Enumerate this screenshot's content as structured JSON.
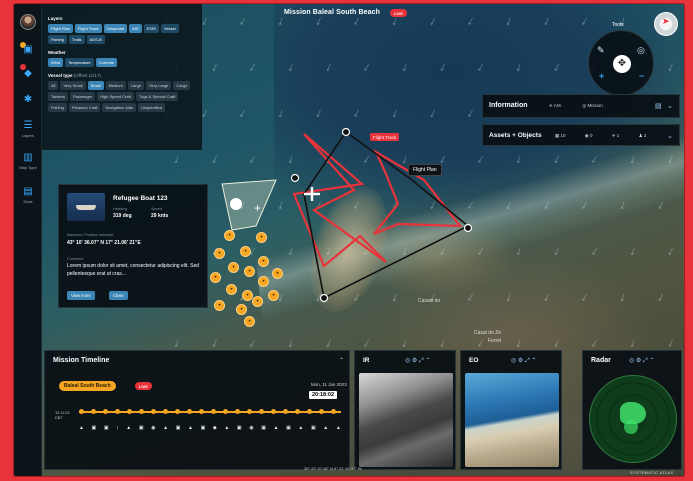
{
  "header": {
    "title": "Mission Baleal South Beach",
    "live": "LIVE"
  },
  "rail": [
    {
      "label": ""
    },
    {
      "label": ""
    },
    {
      "label": ""
    },
    {
      "label": "Layers"
    },
    {
      "label": "Map Type"
    },
    {
      "label": "Docs"
    }
  ],
  "layers": {
    "title": "Layers",
    "layer_chips": [
      "Flight Plan",
      "Flight Track",
      "Geoportal",
      "AIS",
      "ESRI",
      "Vessel",
      "Fishing",
      "Trails",
      "ADS-B"
    ],
    "weather_title": "Weather",
    "weather_chips": [
      "Wind",
      "Temperature",
      "Currents"
    ],
    "vessel_title": "Vessel type",
    "vessel_subtitle": "(Offset 11/17)",
    "vessel_chips": [
      "All",
      "Very Small",
      "Small",
      "Medium",
      "Large",
      "Very Large",
      "Cargo",
      "Tankers",
      "Passenger",
      "High Speed Craft",
      "Tugs & Special Craft",
      "Fishing",
      "Pleasure Craft",
      "Navigation Aids",
      "Unspecified"
    ]
  },
  "tools": {
    "label": "Tools"
  },
  "information": {
    "title": "Information",
    "tabs": [
      "AIS",
      "Mission"
    ]
  },
  "assets": {
    "title": "Assets + Objects",
    "stats": [
      "10",
      "0",
      "1",
      "2"
    ]
  },
  "map": {
    "flight_track_tag": "Flight Track",
    "flight_plan_tag": "Flight Plan",
    "place_1": "Casais do",
    "place_2": "Casal do Zé",
    "place_3": "Ferrel"
  },
  "vessel": {
    "name": "Refugee Boat 123",
    "heading_label": "Heading",
    "heading_value": "319 deg",
    "speed_label": "Speed",
    "speed_value": "29 knts",
    "position_label": "Maximum Position estimate",
    "position_value": "43° 10' 36.07\" N 17° 21.06' 21\"E",
    "comment_label": "Comment",
    "comment_text": "Lorem ipsum dolor sit amet, consectetur adipiscing elit. Sed pellentesque erat ut cras...",
    "btn_view": "View more",
    "btn_close": "Close"
  },
  "timeline": {
    "title": "Mission Timeline",
    "mission": "Baleal South Beach",
    "live": "LIVE",
    "date": "Mon, 11 Jan 2023",
    "now": "20:18:02",
    "axis_top": "10:11:23",
    "axis_bottom": "DBT"
  },
  "ir": {
    "title": "IR"
  },
  "eo": {
    "title": "EO"
  },
  "radar": {
    "title": "Radar"
  },
  "footer": {
    "coords": "39° 20' 37.48\" N 9° 21' 40.37\" W",
    "brand": "SYSTEMATIC ATLAS"
  }
}
